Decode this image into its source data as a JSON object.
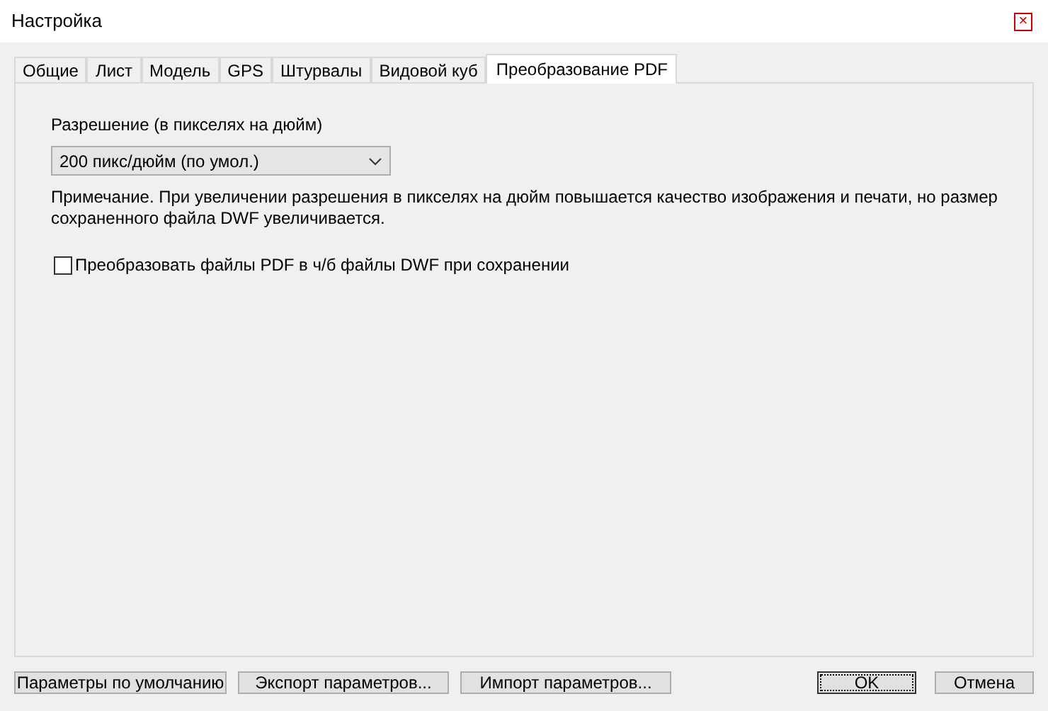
{
  "window": {
    "title": "Настройка",
    "close": "×"
  },
  "tabs": [
    {
      "label": "Общие",
      "selected": false
    },
    {
      "label": "Лист",
      "selected": false
    },
    {
      "label": "Модель",
      "selected": false
    },
    {
      "label": "GPS",
      "selected": false
    },
    {
      "label": "Штурвалы",
      "selected": false
    },
    {
      "label": "Видовой куб",
      "selected": false
    },
    {
      "label": "Преобразование PDF",
      "selected": true
    }
  ],
  "resolution": {
    "label": "Разрешение (в пикселях на дюйм)",
    "value": "200 пикс/дюйм (по умол.)"
  },
  "note": "Примечание. При увеличении разрешения в пикселях на дюйм повышается качество изображения и печати, но размер сохраненного файла DWF увеличивается.",
  "convert_checkbox": {
    "label": "Преобразовать файлы PDF в ч/б файлы DWF при сохранении",
    "checked": false
  },
  "left_buttons": [
    "Параметры по умолчанию",
    "Экспорт параметров...",
    "Импорт параметров..."
  ],
  "right_buttons": [
    {
      "label": "OK",
      "focused": true
    },
    {
      "label": "Отмена",
      "focused": false
    }
  ]
}
